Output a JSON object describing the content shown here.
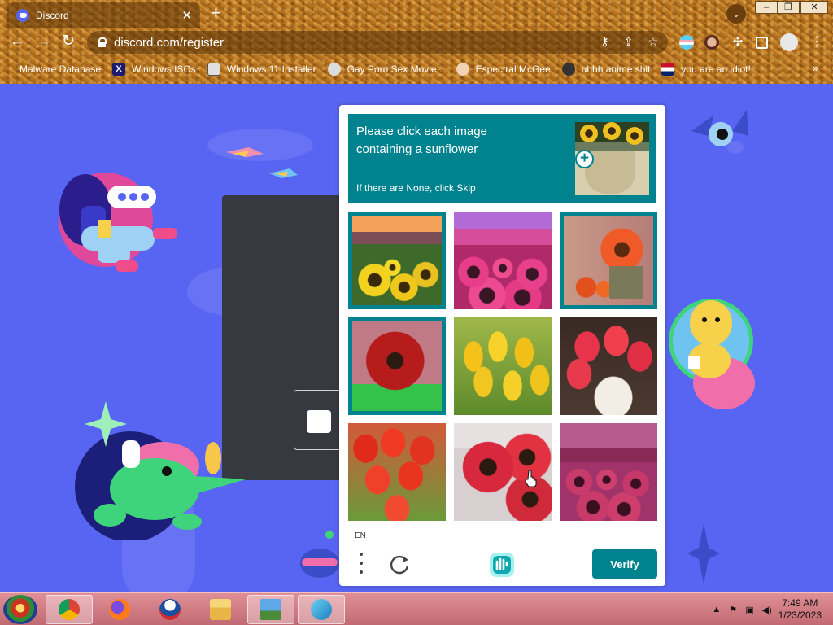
{
  "browser": {
    "tab_title": "Discord",
    "tab_close": "✕",
    "new_tab": "+",
    "url": "discord.com/register",
    "window_buttons": [
      "–",
      "❐",
      "✕"
    ],
    "bookmarks": [
      {
        "label": "Malware Database",
        "icon": "bookmark-icon"
      },
      {
        "label": "Windows ISOs",
        "icon": "x-logo-icon"
      },
      {
        "label": "Windows 11 Installer",
        "icon": "image-icon"
      },
      {
        "label": "Gay Porn Sex Movie...",
        "icon": "globe-icon"
      },
      {
        "label": "Espectral McGee",
        "icon": "avatar-icon"
      },
      {
        "label": "uhhh anime shit",
        "icon": "anime-icon"
      },
      {
        "label": "you are an idiot!",
        "icon": "flag-icon"
      }
    ],
    "bookmarks_overflow": "»"
  },
  "captcha": {
    "prompt_title": "Please click each image containing a sunflower",
    "prompt_hint": "If there are None, click Skip",
    "language": "EN",
    "verify_label": "Verify",
    "tiles": [
      {
        "subject": "sunflower field at sunset",
        "selected": true
      },
      {
        "subject": "pink sunflower field",
        "selected": false
      },
      {
        "subject": "orange sunflower in pot",
        "selected": true
      },
      {
        "subject": "red sunflower",
        "selected": true
      },
      {
        "subject": "yellow tulips",
        "selected": false
      },
      {
        "subject": "red tulips in vase",
        "selected": false
      },
      {
        "subject": "red tulip field",
        "selected": false
      },
      {
        "subject": "red sunflower bouquet",
        "selected": false
      },
      {
        "subject": "pink sunflower field dusk",
        "selected": false
      }
    ],
    "colors": {
      "accent": "#00838f",
      "page": "#5865f2"
    }
  },
  "taskbar": {
    "time": "7:49 AM",
    "date": "1/23/2023",
    "apps": [
      "start-orb",
      "chrome",
      "firefox",
      "obama",
      "file-explorer",
      "photos",
      "dolphin"
    ]
  }
}
